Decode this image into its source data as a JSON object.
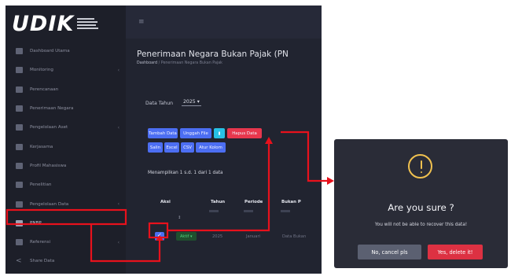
{
  "app": {
    "logo_text": "UDIK",
    "sidebar": {
      "items": [
        {
          "label": "Dashboard Utama",
          "icon": "grid-icon",
          "chevron": ""
        },
        {
          "label": "Monitoring",
          "icon": "grid-icon",
          "chevron": "‹"
        },
        {
          "label": "Perencanaan",
          "icon": "grid-icon",
          "chevron": ""
        },
        {
          "label": "Penerimaan Negara",
          "icon": "grid-icon",
          "chevron": ""
        },
        {
          "label": "Pengelolaan Aset",
          "icon": "grid-icon",
          "chevron": "‹"
        },
        {
          "label": "Kerjasama",
          "icon": "grid-icon",
          "chevron": ""
        },
        {
          "label": "Profil Mahasiswa",
          "icon": "grid-icon",
          "chevron": ""
        },
        {
          "label": "Penelitian",
          "icon": "grid-icon",
          "chevron": ""
        },
        {
          "label": "Pengelolaan Data",
          "icon": "grid-icon",
          "chevron": "‹"
        },
        {
          "label": "PNBP",
          "icon": "grid-icon",
          "chevron": ""
        },
        {
          "label": "Referensi",
          "icon": "grid-icon",
          "chevron": "‹"
        },
        {
          "label": "Share Data",
          "icon": "share-icon",
          "chevron": ""
        }
      ],
      "active_index": 9
    },
    "topbar": {
      "menu_icon": "≡"
    },
    "page_title": "Penerimaan Negara Bukan Pajak (PN",
    "breadcrumb": {
      "home": "Dashboard",
      "separator": "/",
      "current": "Penerimaan Negara Bukan Pajak"
    },
    "year_filter": {
      "label": "Data Tahun",
      "value": "2025 ▾"
    },
    "toolbar": {
      "add_label": "Tambah Data",
      "upload_label": "Unggah File",
      "file_icon_label": "▮",
      "delete_label": "Hapus Data",
      "copy_label": "Salin",
      "excel_label": "Excel",
      "csv_label": "CSV",
      "columns_label": "Atur Kolom"
    },
    "showing_text": "Menampilkan 1 s.d. 1 dari 1 data",
    "table": {
      "headers": [
        "Aksi",
        "Tahun",
        "Periode",
        "Bukan P"
      ],
      "filter_hint": "↕",
      "row": {
        "check": "✓",
        "status": "Aktif ▾",
        "year": "2025",
        "period": "Januari",
        "value": "Data Bukan"
      }
    }
  },
  "dialog": {
    "title": "Are you sure ?",
    "message": "You will not be able to recover this data!",
    "cancel_label": "No, cancel pls",
    "confirm_label": "Yes, delete it!",
    "icon": "exclamation-circle-icon",
    "accent_color": "#f0c14f"
  },
  "annotation": {
    "color": "#e8111c"
  }
}
